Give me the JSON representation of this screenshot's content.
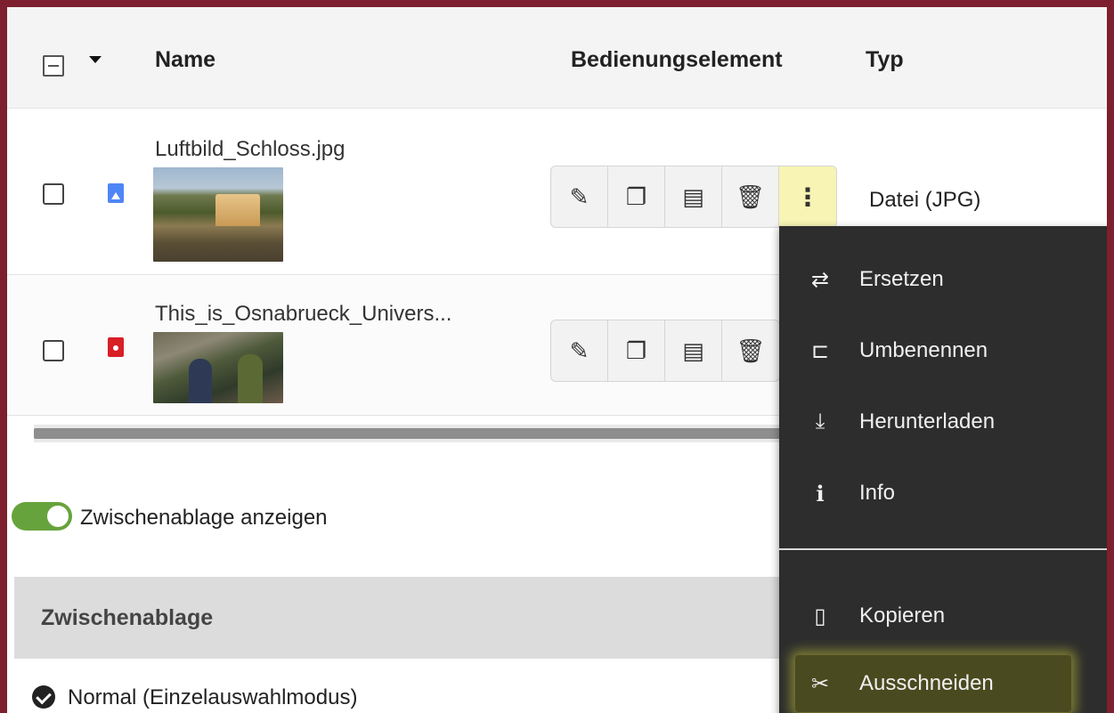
{
  "header": {
    "name_col": "Name",
    "control_col": "Bedienungselement",
    "type_col": "Typ"
  },
  "files": [
    {
      "name": "Luftbild_Schloss.jpg",
      "type": "Datei (JPG)",
      "icon": "image-file-icon"
    },
    {
      "name": "This_is_Osnabrueck_Univers...",
      "type": "",
      "icon": "video-file-icon"
    }
  ],
  "actions": {
    "edit_icon": "pencil-icon",
    "copy_icon": "copy-text-icon",
    "preview_icon": "preview-icon",
    "delete_icon": "trash-icon",
    "more_icon": "more-vertical-icon",
    "more_glyph": "⋮"
  },
  "context_menu": {
    "items": [
      {
        "label": "Ersetzen",
        "icon": "replace-icon"
      },
      {
        "label": "Umbenennen",
        "icon": "rename-icon"
      },
      {
        "label": "Herunterladen",
        "icon": "download-icon"
      },
      {
        "label": "Info",
        "icon": "info-icon"
      },
      {
        "label": "Kopieren",
        "icon": "clipboard-icon"
      },
      {
        "label": "Ausschneiden",
        "icon": "scissors-icon",
        "highlighted": true
      }
    ]
  },
  "clipboard": {
    "toggle_label": "Zwischenablage anzeigen",
    "toggle_on": true,
    "title": "Zwischenablage",
    "mode_label": "Normal (Einzelauswahlmodus)"
  },
  "colors": {
    "frame": "#7d1f2e",
    "toggle_on": "#67a33c",
    "menu_bg": "#2d2d2d",
    "highlight": "#f7f4b4"
  }
}
